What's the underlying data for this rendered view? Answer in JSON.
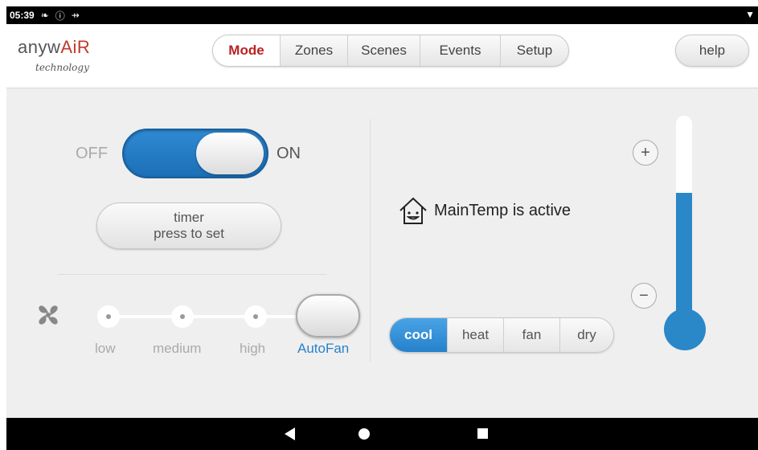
{
  "status_bar": {
    "time": "05:39"
  },
  "header": {
    "logo": {
      "text_main": "anyw",
      "text_accent": "AiR",
      "tagline": "technology"
    },
    "tabs": [
      {
        "label": "Mode",
        "active": true
      },
      {
        "label": "Zones",
        "active": false
      },
      {
        "label": "Scenes",
        "active": false
      },
      {
        "label": "Events",
        "active": false
      },
      {
        "label": "Setup",
        "active": false
      }
    ],
    "help_label": "help"
  },
  "power": {
    "off_label": "OFF",
    "on_label": "ON",
    "state": "on"
  },
  "timer": {
    "line1": "timer",
    "line2": "press to set"
  },
  "fan_speed": {
    "icon": "fan-icon",
    "options": [
      "low",
      "medium",
      "high",
      "AutoFan"
    ],
    "selected": "AutoFan"
  },
  "status": {
    "icon": "house-smiley-icon",
    "text": "MainTemp is active"
  },
  "modes": {
    "options": [
      {
        "label": "cool",
        "active": true
      },
      {
        "label": "heat",
        "active": false
      },
      {
        "label": "fan",
        "active": false
      },
      {
        "label": "dry",
        "active": false
      }
    ]
  },
  "thermostat": {
    "increase_label": "+",
    "decrease_label": "−",
    "level_fraction": 0.63
  },
  "colors": {
    "accent_blue": "#2a87c8",
    "active_tab_red": "#b22222"
  }
}
